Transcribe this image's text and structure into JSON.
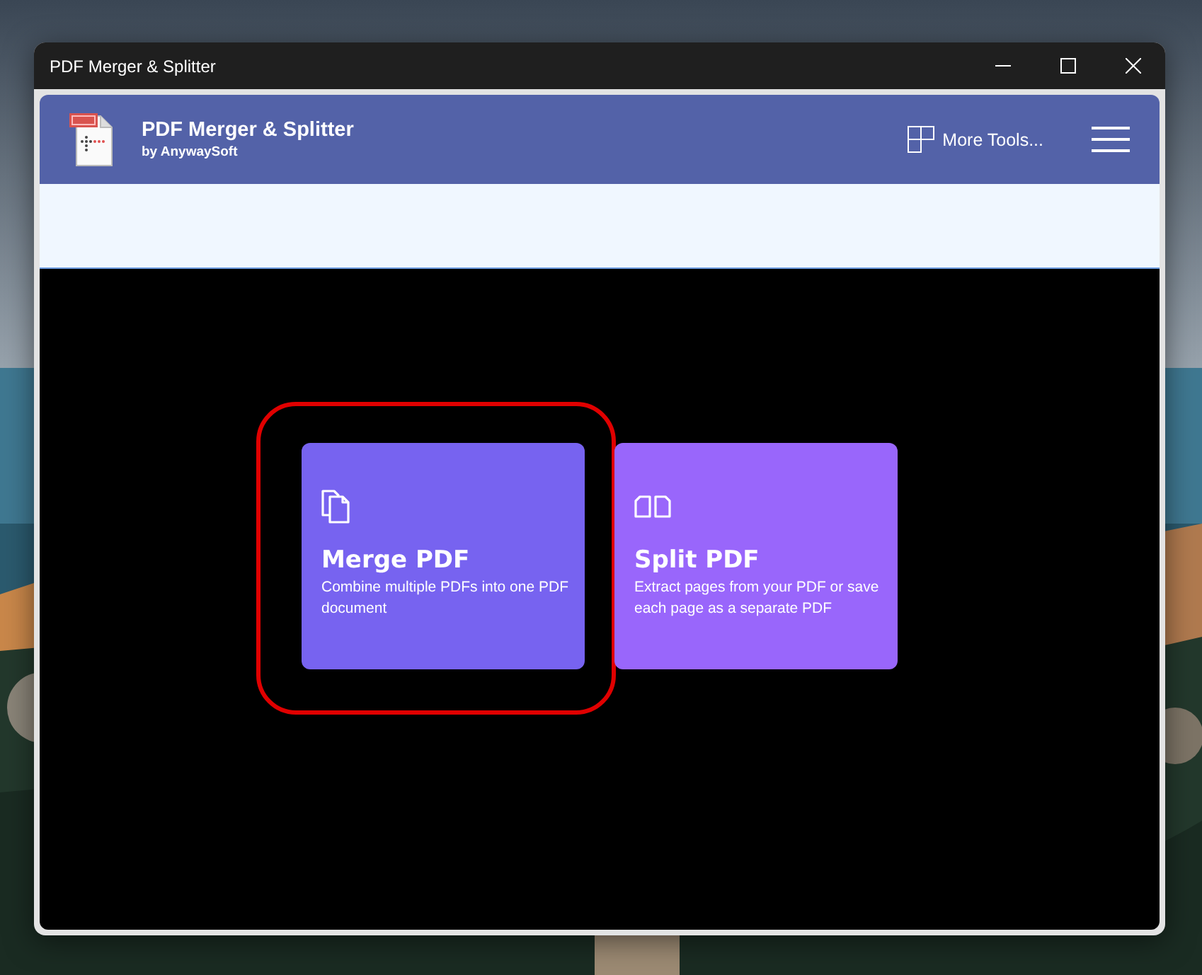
{
  "window": {
    "title": "PDF Merger & Splitter",
    "controls": [
      {
        "kind": "minimize"
      },
      {
        "kind": "maximize"
      },
      {
        "kind": "close"
      }
    ]
  },
  "header": {
    "app_name": "PDF Merger & Splitter",
    "publisher": "by AnywaySoft",
    "more_tools": "More Tools..."
  },
  "tools": [
    {
      "kind": "merge",
      "title": "Merge PDF",
      "description": "Combine multiple PDFs into one PDF document",
      "color": "#7763f0",
      "highlighted": true
    },
    {
      "kind": "split",
      "title": "Split PDF",
      "description": "Extract pages from your PDF or save each page as a separate PDF",
      "color": "#9966fb",
      "highlighted": false
    }
  ]
}
